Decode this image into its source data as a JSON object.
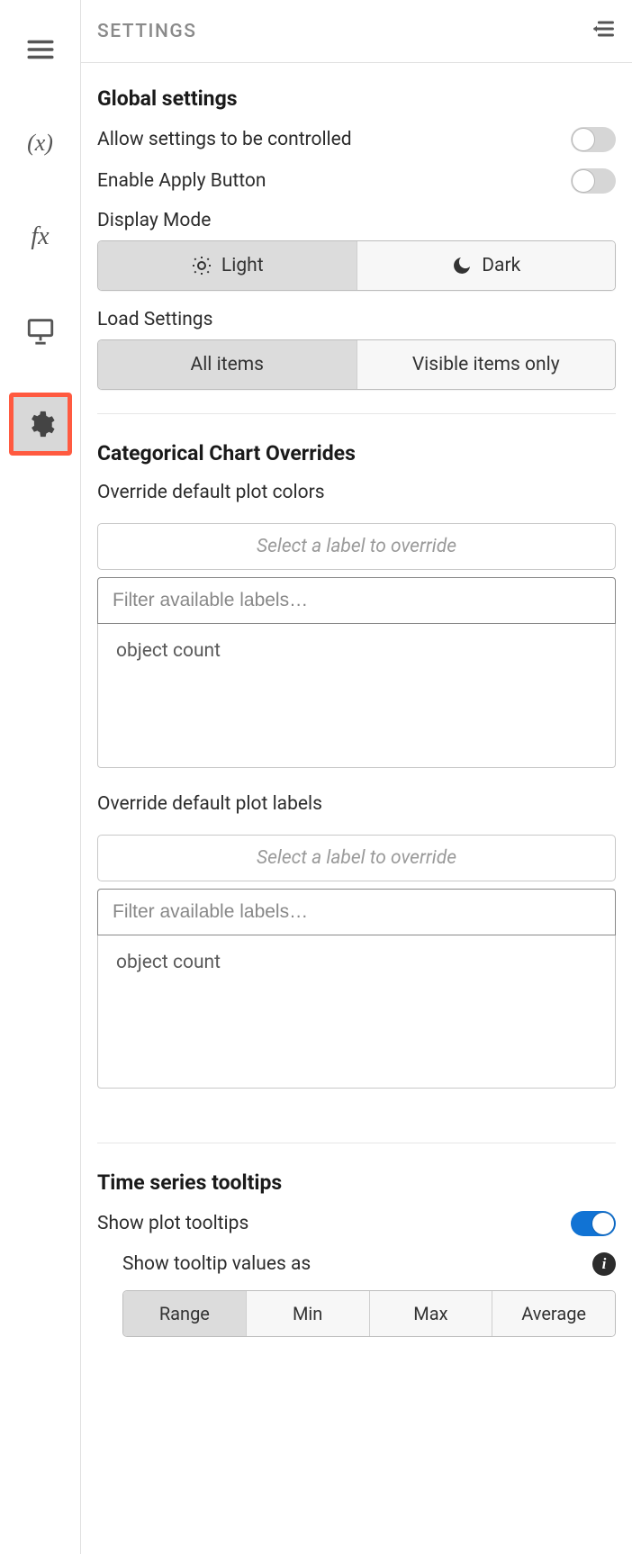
{
  "header": {
    "title": "SETTINGS"
  },
  "sidebar": {
    "items": [
      {
        "name": "menu"
      },
      {
        "name": "variable"
      },
      {
        "name": "function"
      },
      {
        "name": "presentation"
      },
      {
        "name": "settings",
        "active": true
      }
    ]
  },
  "global": {
    "title": "Global settings",
    "allow_label": "Allow settings to be controlled",
    "allow_on": false,
    "apply_label": "Enable Apply Button",
    "apply_on": false,
    "display_mode_label": "Display Mode",
    "display_mode": {
      "light": "Light",
      "dark": "Dark",
      "selected": "light"
    },
    "load_settings_label": "Load Settings",
    "load_settings": {
      "all": "All items",
      "visible": "Visible items only",
      "selected": "all"
    }
  },
  "categorical": {
    "title": "Categorical Chart Overrides",
    "colors_label": "Override default plot colors",
    "labels_label": "Override default plot labels",
    "select_placeholder": "Select a label to override",
    "filter_placeholder": "Filter available labels…",
    "options": [
      "object count"
    ]
  },
  "tooltips": {
    "title": "Time series tooltips",
    "show_label": "Show plot tooltips",
    "show_on": true,
    "values_as_label": "Show tooltip values as",
    "modes": {
      "range": "Range",
      "min": "Min",
      "max": "Max",
      "average": "Average",
      "selected": "range"
    }
  }
}
